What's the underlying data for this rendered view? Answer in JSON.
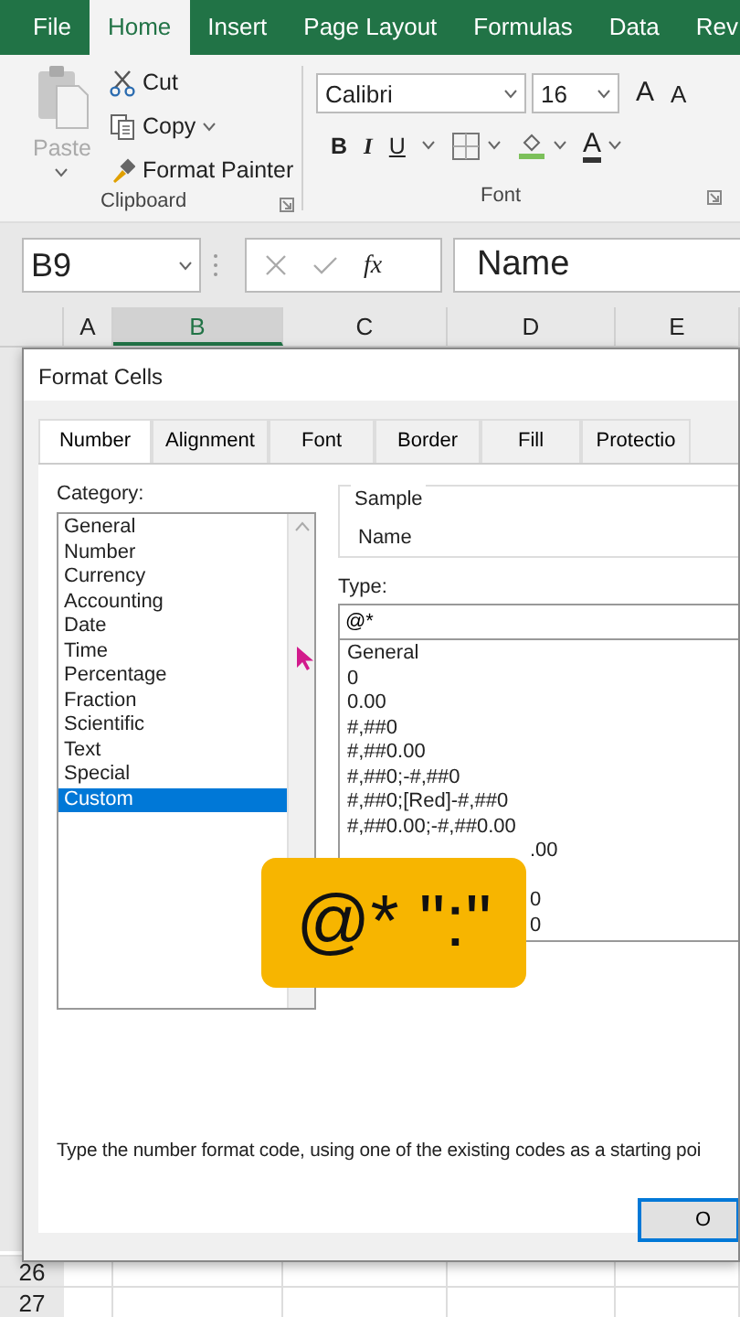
{
  "ribbon_tabs": [
    {
      "label": "File",
      "selected": false
    },
    {
      "label": "Home",
      "selected": true
    },
    {
      "label": "Insert",
      "selected": false
    },
    {
      "label": "Page Layout",
      "selected": false
    },
    {
      "label": "Formulas",
      "selected": false
    },
    {
      "label": "Data",
      "selected": false
    },
    {
      "label": "Rev",
      "selected": false
    }
  ],
  "clipboard": {
    "paste": "Paste",
    "cut": "Cut",
    "copy": "Copy",
    "format_painter": "Format Painter",
    "label": "Clipboard"
  },
  "font_group": {
    "font_name": "Calibri",
    "font_size": "16",
    "grow_font": "A",
    "shrink_font": "A",
    "bold": "B",
    "italic": "I",
    "underline": "U",
    "font_color": "A",
    "label": "Font"
  },
  "formula_bar": {
    "name_box": "B9",
    "insert_function": "fx",
    "value": "Name"
  },
  "columns": [
    {
      "label": "A",
      "selected": false
    },
    {
      "label": "B",
      "selected": true
    },
    {
      "label": "C",
      "selected": false
    },
    {
      "label": "D",
      "selected": false
    },
    {
      "label": "E",
      "selected": false
    }
  ],
  "rows": [
    "26",
    "27"
  ],
  "dialog": {
    "title": "Format Cells",
    "tabs": [
      {
        "label": "Number",
        "selected": true
      },
      {
        "label": "Alignment",
        "selected": false
      },
      {
        "label": "Font",
        "selected": false
      },
      {
        "label": "Border",
        "selected": false
      },
      {
        "label": "Fill",
        "selected": false
      },
      {
        "label": "Protectio",
        "selected": false
      }
    ],
    "category_label": "Category:",
    "categories": [
      {
        "label": "General",
        "selected": false
      },
      {
        "label": "Number",
        "selected": false
      },
      {
        "label": "Currency",
        "selected": false
      },
      {
        "label": "Accounting",
        "selected": false
      },
      {
        "label": "Date",
        "selected": false
      },
      {
        "label": "Time",
        "selected": false
      },
      {
        "label": "Percentage",
        "selected": false
      },
      {
        "label": "Fraction",
        "selected": false
      },
      {
        "label": "Scientific",
        "selected": false
      },
      {
        "label": "Text",
        "selected": false
      },
      {
        "label": "Special",
        "selected": false
      },
      {
        "label": "Custom",
        "selected": true
      }
    ],
    "sample_label": "Sample",
    "sample_value": "Name",
    "type_label": "Type:",
    "type_value": "@*",
    "formats": [
      {
        "text": "General",
        "kind": "full"
      },
      {
        "text": "0",
        "kind": "full"
      },
      {
        "text": "0.00",
        "kind": "full"
      },
      {
        "text": "#,##0",
        "kind": "full"
      },
      {
        "text": "#,##0.00",
        "kind": "full"
      },
      {
        "text": "#,##0;-#,##0",
        "kind": "full"
      },
      {
        "text": "#,##0;[Red]-#,##0",
        "kind": "full"
      },
      {
        "text": "#,##0.00;-#,##0.00",
        "kind": "full"
      },
      {
        "text": ".00",
        "kind": "partial"
      },
      {
        "text": "0",
        "kind": "partial-gap"
      },
      {
        "text": "0",
        "kind": "partial"
      }
    ],
    "description": "Type the number format code, using one of the existing codes as a starting poi",
    "ok": "O"
  },
  "overlay_badge": "@* \":\""
}
